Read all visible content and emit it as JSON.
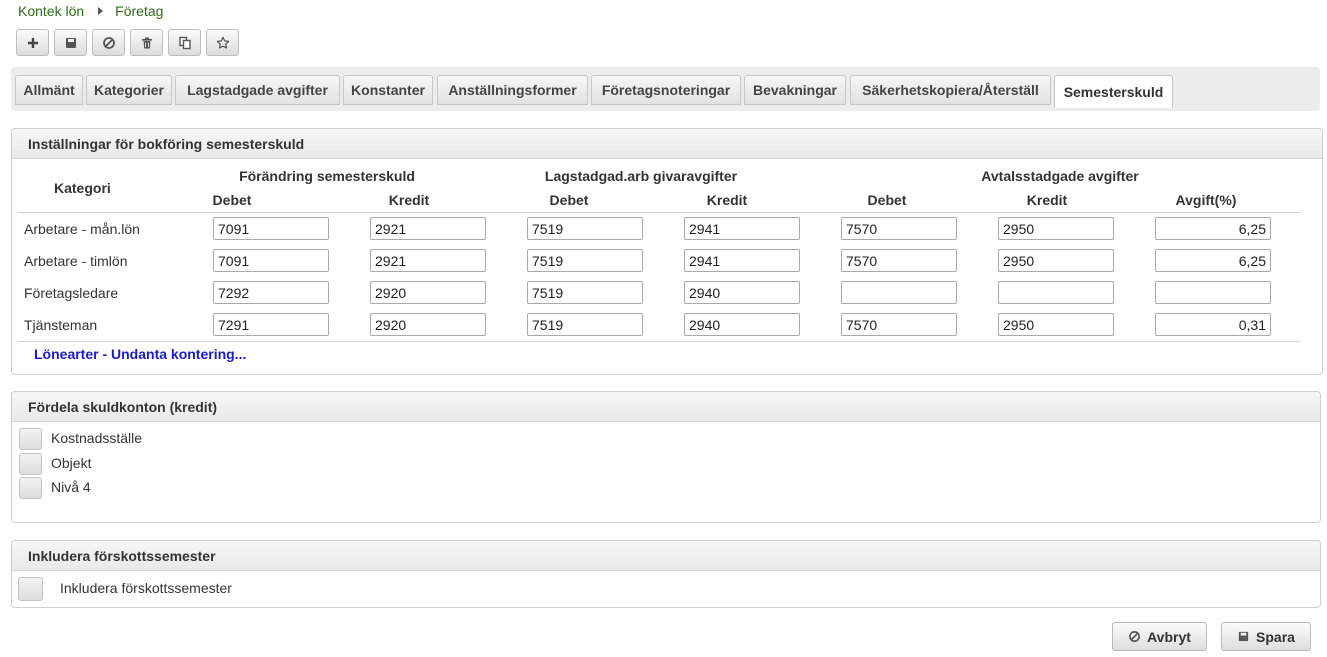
{
  "breadcrumb": {
    "root": "Kontek lön",
    "current": "Företag"
  },
  "toolbar": {
    "icons": [
      "plus-icon",
      "save-icon",
      "cancel-icon",
      "trash-icon",
      "copy-icon",
      "star-icon"
    ]
  },
  "tabs": [
    {
      "label": "Allmänt"
    },
    {
      "label": "Kategorier"
    },
    {
      "label": "Lagstadgade avgifter"
    },
    {
      "label": "Konstanter"
    },
    {
      "label": "Anställningsformer"
    },
    {
      "label": "Företagsnoteringar"
    },
    {
      "label": "Bevakningar"
    },
    {
      "label": "Säkerhetskopiera/Återställ"
    },
    {
      "label": "Semesterskuld",
      "active": true
    }
  ],
  "bookkeeping": {
    "title": "Inställningar för bokföring semesterskuld",
    "col_kategori": "Kategori",
    "group_1": "Förändring semesterskuld",
    "group_2": "Lagstadgad.arb givaravgifter",
    "group_3": "Avtalsstadgade avgifter",
    "sub_debet": "Debet",
    "sub_kredit": "Kredit",
    "sub_avgift": "Avgift(%)",
    "rows": [
      {
        "label": "Arbetare - mån.lön",
        "values": [
          "7091",
          "2921",
          "7519",
          "2941",
          "7570",
          "2950",
          "6,25"
        ]
      },
      {
        "label": "Arbetare - timlön",
        "values": [
          "7091",
          "2921",
          "7519",
          "2941",
          "7570",
          "2950",
          "6,25"
        ]
      },
      {
        "label": "Företagsledare",
        "values": [
          "7292",
          "2920",
          "7519",
          "2940",
          "",
          "",
          ""
        ]
      },
      {
        "label": "Tjänsteman",
        "values": [
          "7291",
          "2920",
          "7519",
          "2940",
          "7570",
          "2950",
          "0,31"
        ]
      }
    ],
    "link": "Lönearter - Undanta kontering..."
  },
  "distribute": {
    "title": "Fördela skuldkonton (kredit)",
    "options": [
      "Kostnadsställe",
      "Objekt",
      "Nivå 4"
    ]
  },
  "include": {
    "title": "Inkludera förskottssemester",
    "option": "Inkludera förskottssemester"
  },
  "footer": {
    "cancel": "Avbryt",
    "save": "Spara"
  },
  "colors": {
    "breadcrumb": "#2e6b1c",
    "link": "#1a1acc"
  }
}
